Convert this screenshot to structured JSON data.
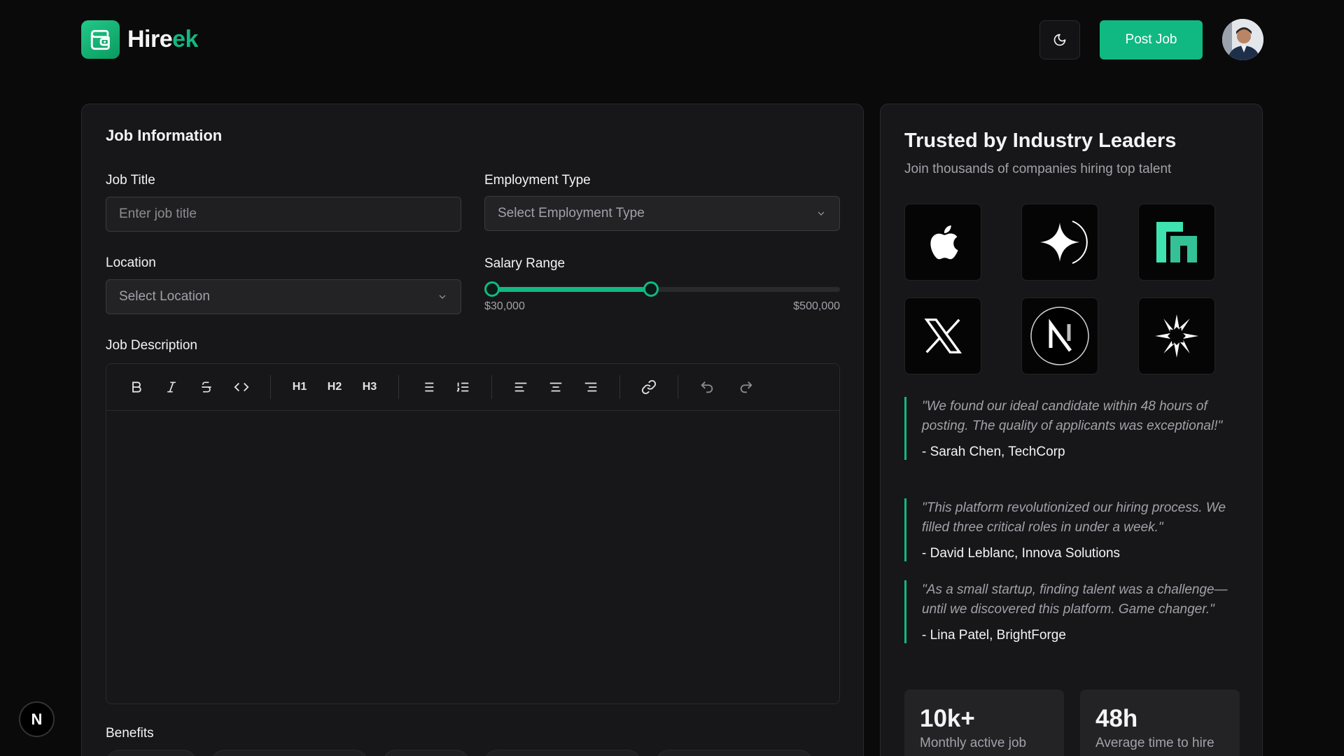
{
  "brand": {
    "name_part1": "Hire",
    "name_part2": "ek",
    "accent": "#10b981"
  },
  "header": {
    "post_job_label": "Post Job",
    "theme_icon": "moon-icon"
  },
  "form": {
    "section_title": "Job Information",
    "job_title": {
      "label": "Job Title",
      "placeholder": "Enter job title",
      "value": ""
    },
    "employment_type": {
      "label": "Employment Type",
      "placeholder": "Select Employment Type"
    },
    "location": {
      "label": "Location",
      "placeholder": "Select Location"
    },
    "salary_range": {
      "label": "Salary Range",
      "min_label": "$30,000",
      "max_label": "$500,000",
      "low_fraction": 0.0,
      "high_fraction": 0.467
    },
    "description": {
      "label": "Job Description",
      "toolbar": [
        "bold-icon",
        "italic-icon",
        "strikethrough-icon",
        "code-icon",
        "heading1-icon",
        "heading2-icon",
        "heading3-icon",
        "bullet-list-icon",
        "numbered-list-icon",
        "align-left-icon",
        "align-center-icon",
        "align-right-icon",
        "link-icon",
        "undo-icon",
        "redo-icon"
      ],
      "h1": "H1",
      "h2": "H2",
      "h3": "H3"
    },
    "benefits": {
      "label": "Benefits"
    }
  },
  "side": {
    "title": "Trusted by Industry Leaders",
    "subtitle": "Join thousands of companies hiring top talent",
    "logos": [
      "apple-logo-icon",
      "sparkle-logo-icon",
      "n-block-logo-icon",
      "x-logo-icon",
      "n-circle-logo-icon",
      "burst-logo-icon"
    ],
    "testimonials": [
      {
        "quote": "\"We found our ideal candidate within 48 hours of posting. The quality of applicants was exceptional!\"",
        "author": "- Sarah Chen, TechCorp"
      },
      {
        "quote": "\"This platform revolutionized our hiring process. We filled three critical roles in under a week.\"",
        "author": "- David Leblanc, Innova Solutions"
      },
      {
        "quote": "\"As a small startup, finding talent was a challenge—until we discovered this platform. Game changer.\"",
        "author": "- Lina Patel, BrightForge"
      }
    ],
    "stats": [
      {
        "value": "10k+",
        "label": "Monthly active job"
      },
      {
        "value": "48h",
        "label": "Average time to hire"
      }
    ]
  },
  "devtools_badge": "N"
}
